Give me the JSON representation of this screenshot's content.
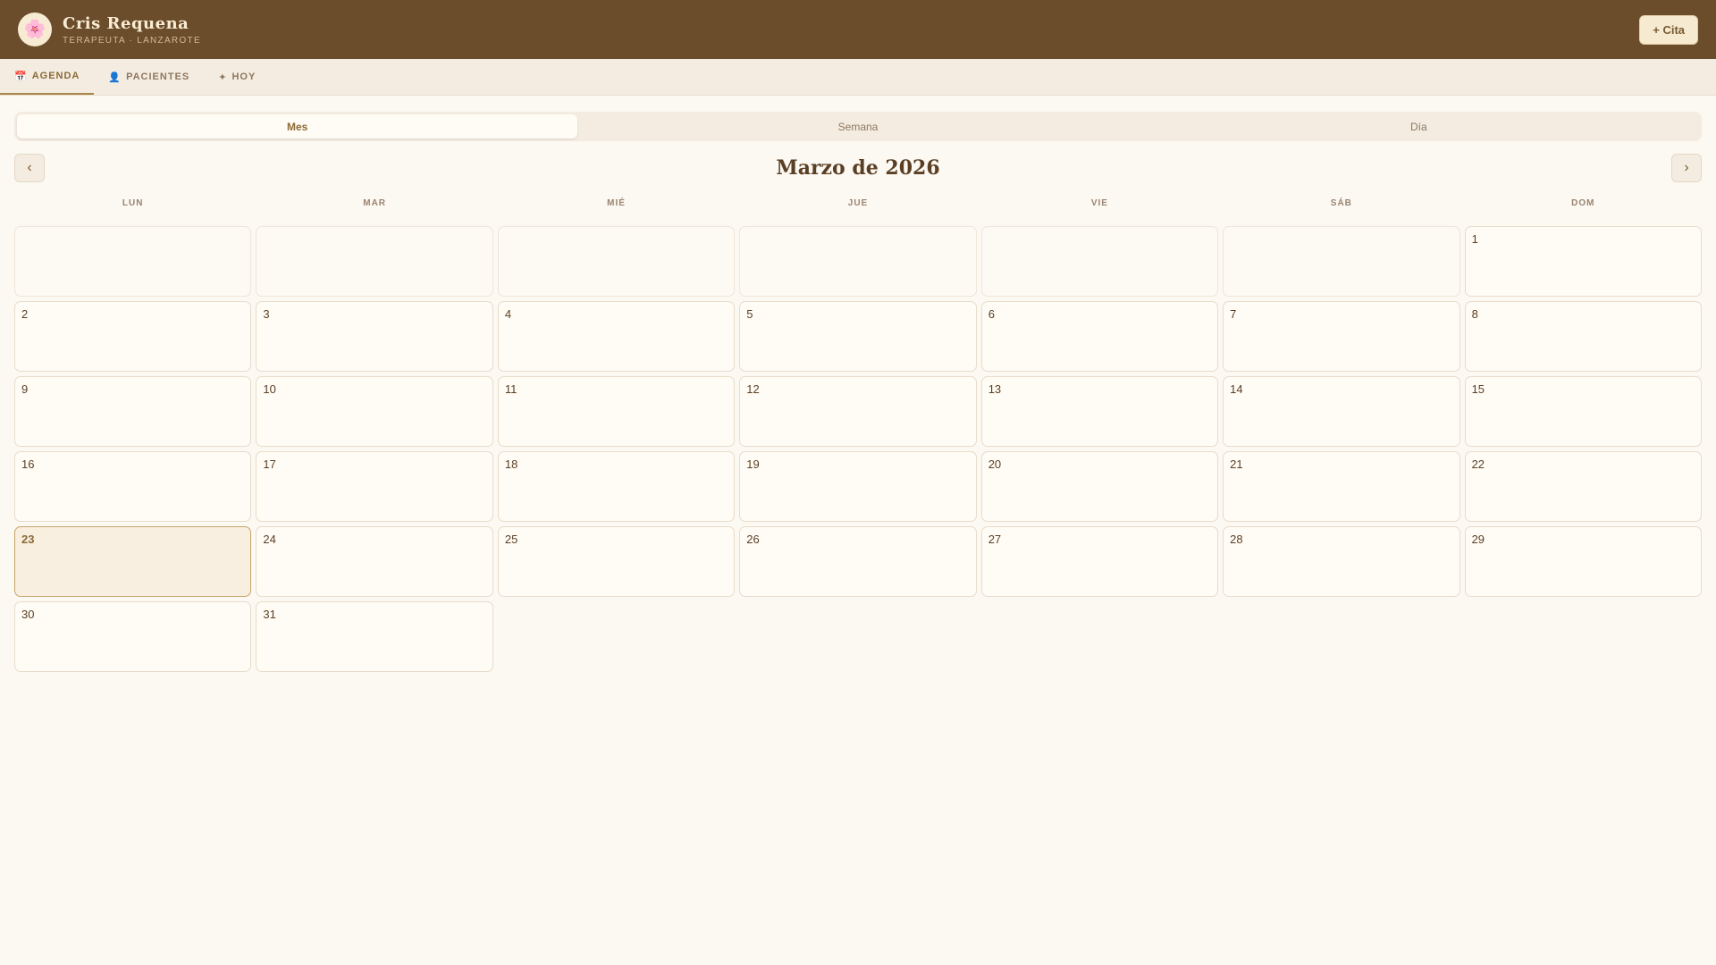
{
  "header": {
    "avatar_icon": "flower-icon",
    "avatar_glyph": "🌸",
    "name": "Cris Requena",
    "subtitle": "TERAPEUTA · LANZAROTE",
    "add_button": "+ Cita"
  },
  "nav": {
    "tabs": [
      {
        "icon": "📅",
        "icon_name": "calendar-icon",
        "label": "AGENDA",
        "active": true
      },
      {
        "icon": "👤",
        "icon_name": "person-icon",
        "label": "PACIENTES",
        "active": false
      },
      {
        "icon": "✦",
        "icon_name": "sparkle-icon",
        "label": "HOY",
        "active": false
      }
    ]
  },
  "view_switch": {
    "options": [
      "Mes",
      "Semana",
      "Día"
    ],
    "selected": "Mes"
  },
  "calendar": {
    "title": "Marzo de 2026",
    "prev_label": "‹",
    "next_label": "›",
    "weekdays": [
      "LUN",
      "MAR",
      "MIÉ",
      "JUE",
      "VIE",
      "SÁB",
      "DOM"
    ],
    "leading_empty_days": 6,
    "days_in_month": 31,
    "today": 23
  },
  "colors": {
    "header_bg": "#6b4c2b",
    "accent": "#8b6a36",
    "page_bg": "#fcf8f2",
    "today_bg": "#f8efe1"
  }
}
